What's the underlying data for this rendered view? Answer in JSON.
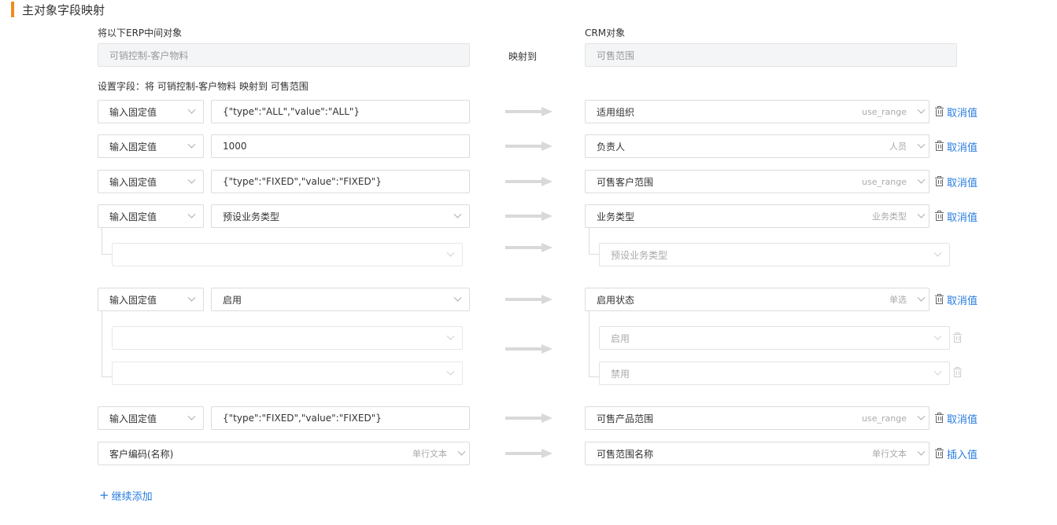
{
  "section": {
    "title": "主对象字段映射"
  },
  "labels": {
    "erp_object": "将以下ERP中间对象",
    "crm_object": "CRM对象",
    "mapped_to": "映射到",
    "set_fields": "设置字段：将 可销控制-客户物料 映射到 可售范围"
  },
  "objects": {
    "erp_value": "可销控制-客户物料",
    "crm_value": "可售范围"
  },
  "rows": [
    {
      "source_type": "输入固定值",
      "source_value": "{\"type\":\"ALL\",\"value\":\"ALL\"}",
      "target": "适用组织",
      "target_hint": "use_range",
      "action": "取消值"
    },
    {
      "source_type": "输入固定值",
      "source_value": "1000",
      "target": "负责人",
      "target_hint": "人员",
      "action": "取消值"
    },
    {
      "source_type": "输入固定值",
      "source_value": "{\"type\":\"FIXED\",\"value\":\"FIXED\"}",
      "target": "可售客户范围",
      "target_hint": "use_range",
      "action": "取消值"
    },
    {
      "source_type": "输入固定值",
      "source_value": "预设业务类型",
      "target": "业务类型",
      "target_hint": "业务类型",
      "action": "取消值",
      "sub_target": "预设业务类型"
    },
    {
      "source_type": "输入固定值",
      "source_value": "启用",
      "target": "启用状态",
      "target_hint": "单选",
      "action": "取消值",
      "sub_targets": [
        "启用",
        "禁用"
      ]
    },
    {
      "source_type": "输入固定值",
      "source_value": "{\"type\":\"FIXED\",\"value\":\"FIXED\"}",
      "target": "可售产品范围",
      "target_hint": "use_range",
      "action": "取消值"
    },
    {
      "source_field": "客户编码(名称)",
      "source_hint": "单行文本",
      "target": "可售范围名称",
      "target_hint": "单行文本",
      "action": "插入值"
    }
  ],
  "footer": {
    "add_label": "继续添加"
  },
  "colors": {
    "accent": "#f08c1e",
    "link": "#2a7de1"
  }
}
